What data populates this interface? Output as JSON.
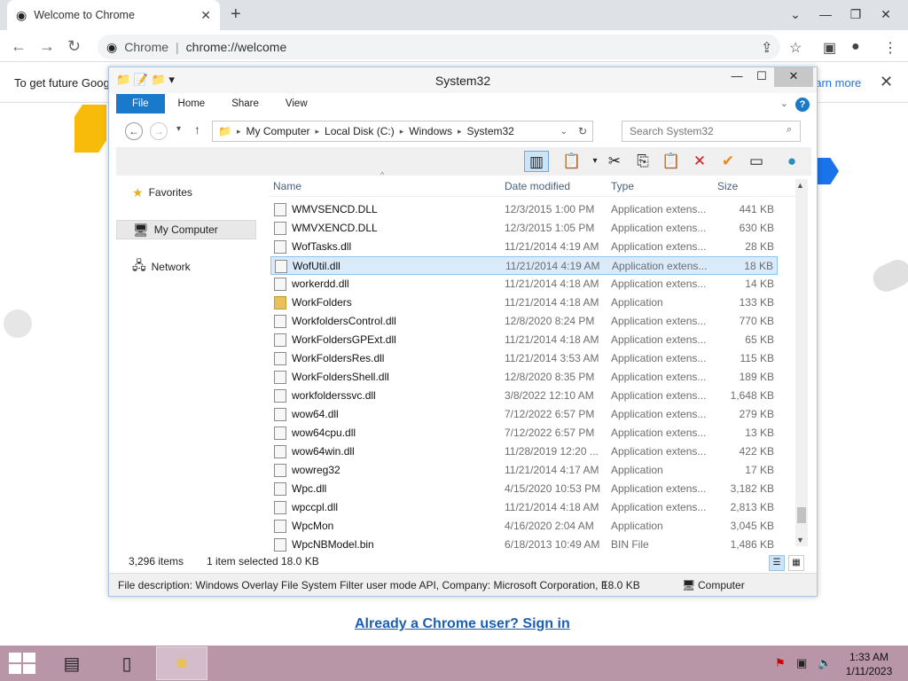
{
  "browser": {
    "tab_title": "Welcome to Chrome",
    "tab_close": "✕",
    "new_tab": "+",
    "omni_label": "Chrome",
    "url": "chrome://welcome",
    "info_text": "To get future Goog",
    "info_more": "earn more",
    "signin_link": "Already a Chrome user? Sign in"
  },
  "explorer": {
    "title": "System32",
    "ribbon_tabs": [
      "File",
      "Home",
      "Share",
      "View"
    ],
    "breadcrumb": [
      "My Computer",
      "Local Disk (C:)",
      "Windows",
      "System32"
    ],
    "search_placeholder": "Search System32",
    "nav": {
      "favorites": "Favorites",
      "computer": "My Computer",
      "network": "Network"
    },
    "columns": {
      "name": "Name",
      "date": "Date modified",
      "type": "Type",
      "size": "Size"
    },
    "files": [
      {
        "name": "WMVSENCD.DLL",
        "date": "12/3/2015 1:00 PM",
        "type": "Application extens...",
        "size": "441 KB",
        "kind": "dll"
      },
      {
        "name": "WMVXENCD.DLL",
        "date": "12/3/2015 1:05 PM",
        "type": "Application extens...",
        "size": "630 KB",
        "kind": "dll"
      },
      {
        "name": "WofTasks.dll",
        "date": "11/21/2014 4:19 AM",
        "type": "Application extens...",
        "size": "28 KB",
        "kind": "dll"
      },
      {
        "name": "WofUtil.dll",
        "date": "11/21/2014 4:19 AM",
        "type": "Application extens...",
        "size": "18 KB",
        "kind": "dll",
        "selected": true
      },
      {
        "name": "workerdd.dll",
        "date": "11/21/2014 4:18 AM",
        "type": "Application extens...",
        "size": "14 KB",
        "kind": "dll"
      },
      {
        "name": "WorkFolders",
        "date": "11/21/2014 4:18 AM",
        "type": "Application",
        "size": "133 KB",
        "kind": "folder"
      },
      {
        "name": "WorkfoldersControl.dll",
        "date": "12/8/2020 8:24 PM",
        "type": "Application extens...",
        "size": "770 KB",
        "kind": "dll"
      },
      {
        "name": "WorkFoldersGPExt.dll",
        "date": "11/21/2014 4:18 AM",
        "type": "Application extens...",
        "size": "65 KB",
        "kind": "dll"
      },
      {
        "name": "WorkFoldersRes.dll",
        "date": "11/21/2014 3:53 AM",
        "type": "Application extens...",
        "size": "115 KB",
        "kind": "dll"
      },
      {
        "name": "WorkFoldersShell.dll",
        "date": "12/8/2020 8:35 PM",
        "type": "Application extens...",
        "size": "189 KB",
        "kind": "dll"
      },
      {
        "name": "workfolderssvc.dll",
        "date": "3/8/2022 12:10 AM",
        "type": "Application extens...",
        "size": "1,648 KB",
        "kind": "dll"
      },
      {
        "name": "wow64.dll",
        "date": "7/12/2022 6:57 PM",
        "type": "Application extens...",
        "size": "279 KB",
        "kind": "dll"
      },
      {
        "name": "wow64cpu.dll",
        "date": "7/12/2022 6:57 PM",
        "type": "Application extens...",
        "size": "13 KB",
        "kind": "dll"
      },
      {
        "name": "wow64win.dll",
        "date": "11/28/2019 12:20 ...",
        "type": "Application extens...",
        "size": "422 KB",
        "kind": "dll"
      },
      {
        "name": "wowreg32",
        "date": "11/21/2014 4:17 AM",
        "type": "Application",
        "size": "17 KB",
        "kind": "app"
      },
      {
        "name": "Wpc.dll",
        "date": "4/15/2020 10:53 PM",
        "type": "Application extens...",
        "size": "3,182 KB",
        "kind": "dll"
      },
      {
        "name": "wpccpl.dll",
        "date": "11/21/2014 4:18 AM",
        "type": "Application extens...",
        "size": "2,813 KB",
        "kind": "dll"
      },
      {
        "name": "WpcMon",
        "date": "4/16/2020 2:04 AM",
        "type": "Application",
        "size": "3,045 KB",
        "kind": "app"
      },
      {
        "name": "WpcNBModel.bin",
        "date": "6/18/2013 10:49 AM",
        "type": "BIN File",
        "size": "1,486 KB",
        "kind": "file"
      }
    ],
    "status": {
      "count": "3,296 items",
      "selected": "1 item selected",
      "size": "18.0 KB"
    },
    "details": {
      "description": "File description: Windows Overlay File System Filter user mode API, Company: Microsoft Corporation, F",
      "size": "18.0 KB",
      "location": "Computer"
    }
  },
  "taskbar": {
    "time": "1:33 AM",
    "date": "1/11/2023"
  },
  "colors": {
    "accent": "#1979ca",
    "selection": "#d9ebfb",
    "taskbar": "#b896a8"
  }
}
